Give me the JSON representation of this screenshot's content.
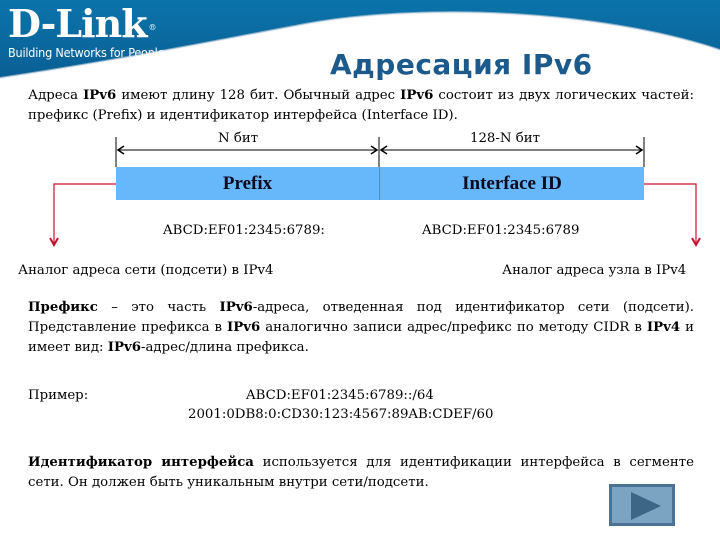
{
  "header": {
    "logo_mark": "D-Link",
    "logo_registered": "®",
    "logo_tagline": "Building Networks for People",
    "title": "Адресация IPv6",
    "colors": {
      "swoosh": "#0b6ea3",
      "title": "#1c5a8c"
    }
  },
  "intro": {
    "p1_a": "Адреса ",
    "p1_b": "IPv6",
    "p1_c": " имеют длину 128 бит. Обычный адрес ",
    "p1_d": "IPv6",
    "p1_e": " состоит из двух логических частей: префикс (Prefix) и идентификатор интерфейса (Interface ID)."
  },
  "diagram": {
    "prefix_bits": "N бит",
    "interface_bits": "128-N бит",
    "prefix_label": "Prefix",
    "interface_label": "Interface ID",
    "prefix_example": "ABCD:EF01:2345:6789:",
    "interface_example": "ABCD:EF01:2345:6789",
    "prefix_analog": "Аналог адреса сети (подсети) в IPv4",
    "interface_analog": "Аналог адреса узла в IPv4",
    "colors": {
      "box_fill": "#66b8fb",
      "connector": "#c8102e"
    }
  },
  "prefix_section": {
    "term": "Префикс",
    "text_a": " – это часть ",
    "ipv6_1": "IPv6",
    "text_b": "-адреса, отведенная под идентификатор сети (подсети). Представление префикса в ",
    "ipv6_2": "IPv6",
    "text_c": " аналогично записи адрес/префикс по методу CIDR в ",
    "ipv4": "IPv4",
    "text_d": " и имеет вид: ",
    "ipv6_3": "IPv6",
    "text_e": "-адрес/длина префикса."
  },
  "example": {
    "label": "Пример:",
    "line1": "ABCD:EF01:2345:6789::/64",
    "line2": "2001:0DB8:0:CD30:123:4567:89AB:CDEF/60"
  },
  "interface_section": {
    "term": "Идентификатор интерфейса",
    "text": " используется для идентификации интерфейса в сегменте сети. Он должен быть уникальным внутри сети/подсети."
  },
  "navigation": {
    "next_icon": "play-triangle-icon",
    "colors": {
      "fill": "#7ba3c2",
      "border": "#4a7396",
      "icon": "#3d6585"
    }
  }
}
